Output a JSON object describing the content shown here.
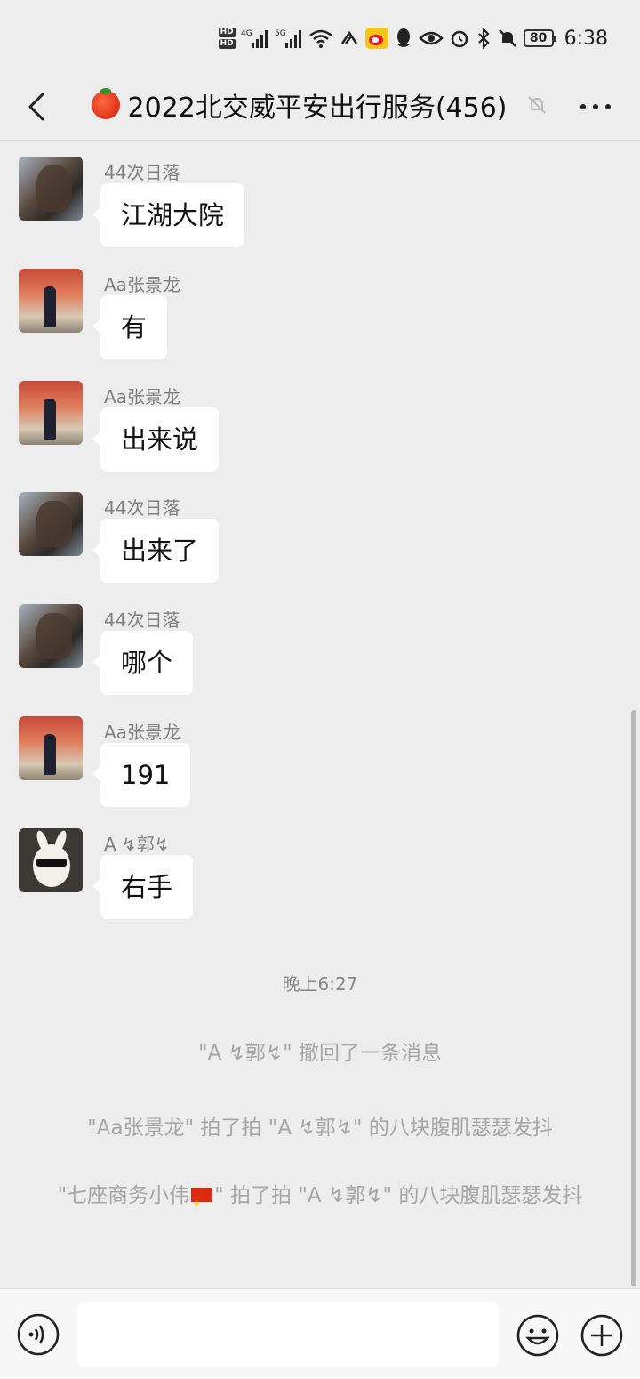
{
  "status_bar": {
    "hd1": "HD",
    "hd2": "HD",
    "signal1_label": "4G",
    "signal2_label": "5G",
    "battery": "80",
    "time": "6:38"
  },
  "header": {
    "title": "2022北交威平安出行服务(456)",
    "icons": [
      "back-arrow-icon",
      "tomato-emoji",
      "mute-bell-icon",
      "more-icon"
    ]
  },
  "messages": [
    {
      "sender": "44次日落",
      "text": "江湖大院",
      "avatar": "avatar-a"
    },
    {
      "sender": "Aa张景龙",
      "text": "有",
      "avatar": "avatar-b"
    },
    {
      "sender": "Aa张景龙",
      "text": "出来说",
      "avatar": "avatar-b"
    },
    {
      "sender": "44次日落",
      "text": "出来了",
      "avatar": "avatar-a"
    },
    {
      "sender": "44次日落",
      "text": "哪个",
      "avatar": "avatar-a"
    },
    {
      "sender": "Aa张景龙",
      "text": "191",
      "avatar": "avatar-b"
    },
    {
      "sender": "A ↯郭↯",
      "text": "右手",
      "avatar": "avatar-rabbit"
    }
  ],
  "system": {
    "time": "晚上6:27",
    "notes": [
      "\"A ↯郭↯\" 撤回了一条消息",
      "\"Aa张景龙\" 拍了拍 \"A ↯郭↯\" 的八块腹肌瑟瑟发抖"
    ],
    "note3_prefix": "\"七座商务小伟",
    "note3_suffix": "\" 拍了拍 \"A ↯郭↯\" 的八块腹肌瑟瑟发抖"
  },
  "input": {
    "placeholder": ""
  },
  "colors": {
    "background": "#ededed",
    "bubble": "#ffffff",
    "sender_text": "#808080",
    "system_text": "#a6a6a6"
  }
}
